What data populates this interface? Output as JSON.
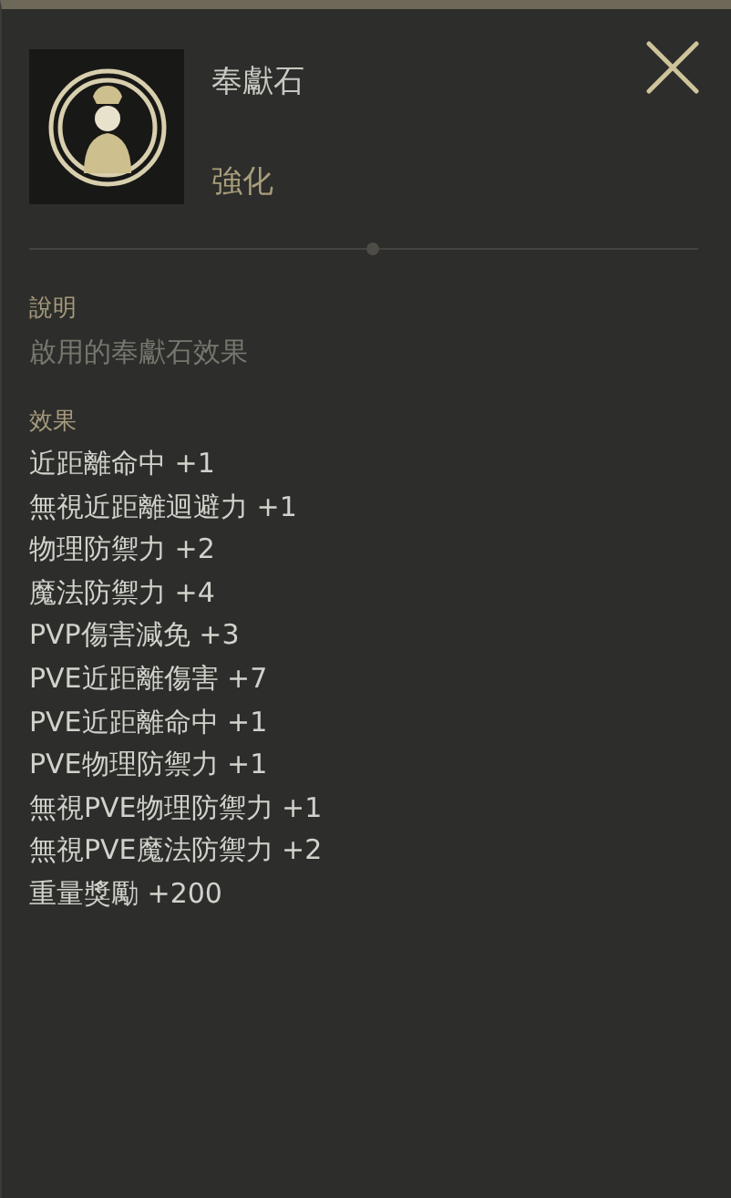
{
  "item": {
    "name": "奉獻石",
    "type": "強化"
  },
  "description": {
    "label": "說明",
    "text": "啟用的奉獻石效果"
  },
  "effects": {
    "label": "效果",
    "lines": [
      "近距離命中 +1",
      "無視近距離迴避力 +1",
      "物理防禦力 +2",
      "魔法防禦力 +4",
      "PVP傷害減免 +3",
      "PVE近距離傷害 +7",
      "PVE近距離命中 +1",
      "PVE物理防禦力 +1",
      "無視PVE物理防禦力 +1",
      "無視PVE魔法防禦力 +2",
      "重量獎勵 +200"
    ]
  }
}
